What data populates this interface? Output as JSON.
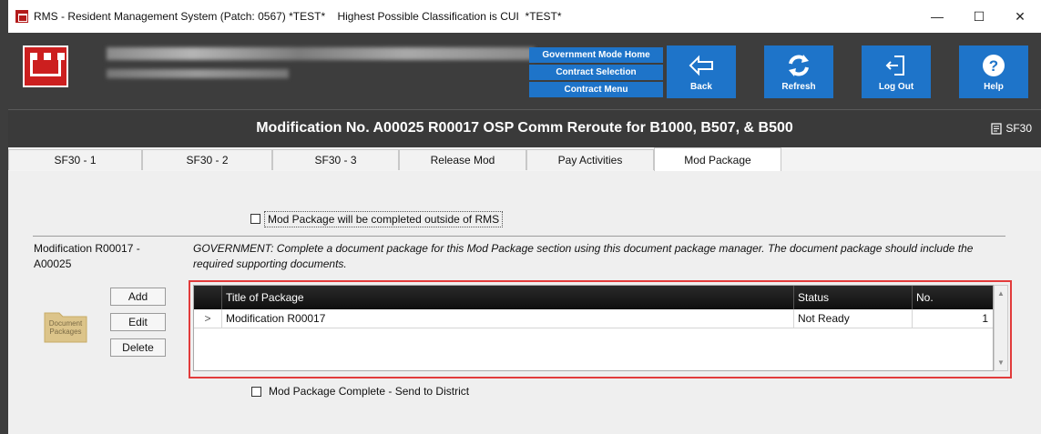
{
  "window": {
    "title": "RMS - Resident Management System (Patch: 0567) *TEST*    Highest Possible Classification is CUI  *TEST*",
    "minimize": "—",
    "maximize": "☐",
    "close": "✕"
  },
  "header": {
    "nav_links": [
      "Government Mode Home",
      "Contract Selection",
      "Contract Menu"
    ],
    "buttons": [
      {
        "label": "Back",
        "icon": "back-arrow-icon"
      },
      {
        "label": "Refresh",
        "icon": "refresh-icon"
      },
      {
        "label": "Log Out",
        "icon": "logout-icon"
      },
      {
        "label": "Help",
        "icon": "help-icon"
      }
    ]
  },
  "banner": {
    "title": "Modification No. A00025 R00017 OSP Comm Reroute for B1000, B507, & B500",
    "sf30_label": "SF30"
  },
  "tabs": [
    "SF30 - 1",
    "SF30 - 2",
    "SF30 - 3",
    "Release Mod",
    "Pay Activities",
    "Mod Package"
  ],
  "active_tab": "Mod Package",
  "main": {
    "outside_rms_label": "Mod Package will be completed outside of RMS",
    "section_label": "Modification R00017 - A00025",
    "instructions": "GOVERNMENT: Complete a document package for this Mod Package section using this document package manager. The document package should include the required supporting documents.",
    "side_buttons": [
      "Add",
      "Edit",
      "Delete"
    ],
    "folder_label": "Document Packages",
    "grid": {
      "columns": [
        "Title of Package",
        "Status",
        "No."
      ],
      "rows": [
        {
          "title": "Modification R00017",
          "status": "Not Ready",
          "no": "1",
          "marker": ">"
        }
      ]
    },
    "complete_label": "Mod Package Complete - Send to District"
  },
  "colors": {
    "accent_blue": "#1e74c9",
    "header_dark": "#3d3d3d",
    "highlight_red": "#e23b3b",
    "logo_red": "#cc1f1f"
  }
}
